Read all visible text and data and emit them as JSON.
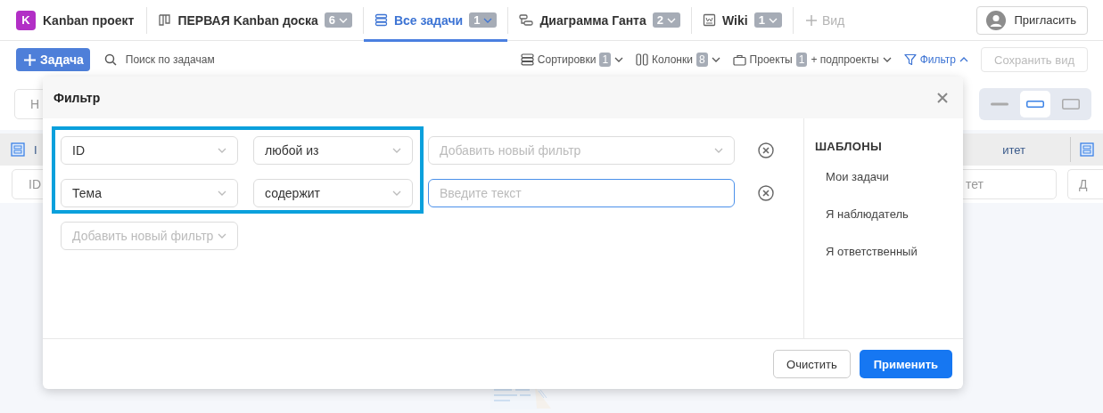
{
  "project": {
    "avatar": "K",
    "name": "Kanban проект"
  },
  "views": [
    {
      "kind": "board",
      "label": "ПЕРВАЯ Kanban доска",
      "count": "6",
      "selected": false
    },
    {
      "kind": "list",
      "label": "Все задачи",
      "count": "1",
      "selected": true
    },
    {
      "kind": "gantt",
      "label": "Диаграмма Ганта",
      "count": "2",
      "selected": false
    },
    {
      "kind": "wiki",
      "label": "Wiki",
      "count": "1",
      "selected": false
    }
  ],
  "add_view": "Вид",
  "invite_button": "Пригласить",
  "toolbar": {
    "new_task": "Задача",
    "search_placeholder": "Поиск по задачам",
    "sorts": {
      "label": "Сортировки",
      "count": "1"
    },
    "columns": {
      "label": "Колонки",
      "count": "8"
    },
    "projects": {
      "label": "Проекты",
      "count": "1",
      "suffix": "+ подпроекты"
    },
    "filter": {
      "label": "Фильтр",
      "expanded": true
    },
    "save_view": {
      "label": "Сохранить вид",
      "disabled": true
    }
  },
  "background": {
    "name_field": "Н",
    "header_left": "I",
    "header_right": "итет",
    "filter_left": "ID",
    "filter_right": "тет",
    "filter_far_right": "Д",
    "density": [
      {
        "selected": false
      },
      {
        "selected": true
      },
      {
        "selected": false
      }
    ]
  },
  "filter_dialog": {
    "title": "Фильтр",
    "rows": [
      {
        "field": "ID",
        "operator": "любой из",
        "value": {
          "kind": "select",
          "placeholder": "Добавить новый фильтр"
        }
      },
      {
        "field": "Тема",
        "operator": "содержит",
        "value": {
          "kind": "text",
          "placeholder": "Введите текст"
        }
      }
    ],
    "add_filter_placeholder": "Добавить новый фильтр",
    "templates": {
      "title": "ШАБЛОНЫ",
      "items": [
        "Мои задачи",
        "Я наблюдатель",
        "Я ответственный"
      ]
    },
    "clear_button": "Очистить",
    "apply_button": "Применить"
  }
}
